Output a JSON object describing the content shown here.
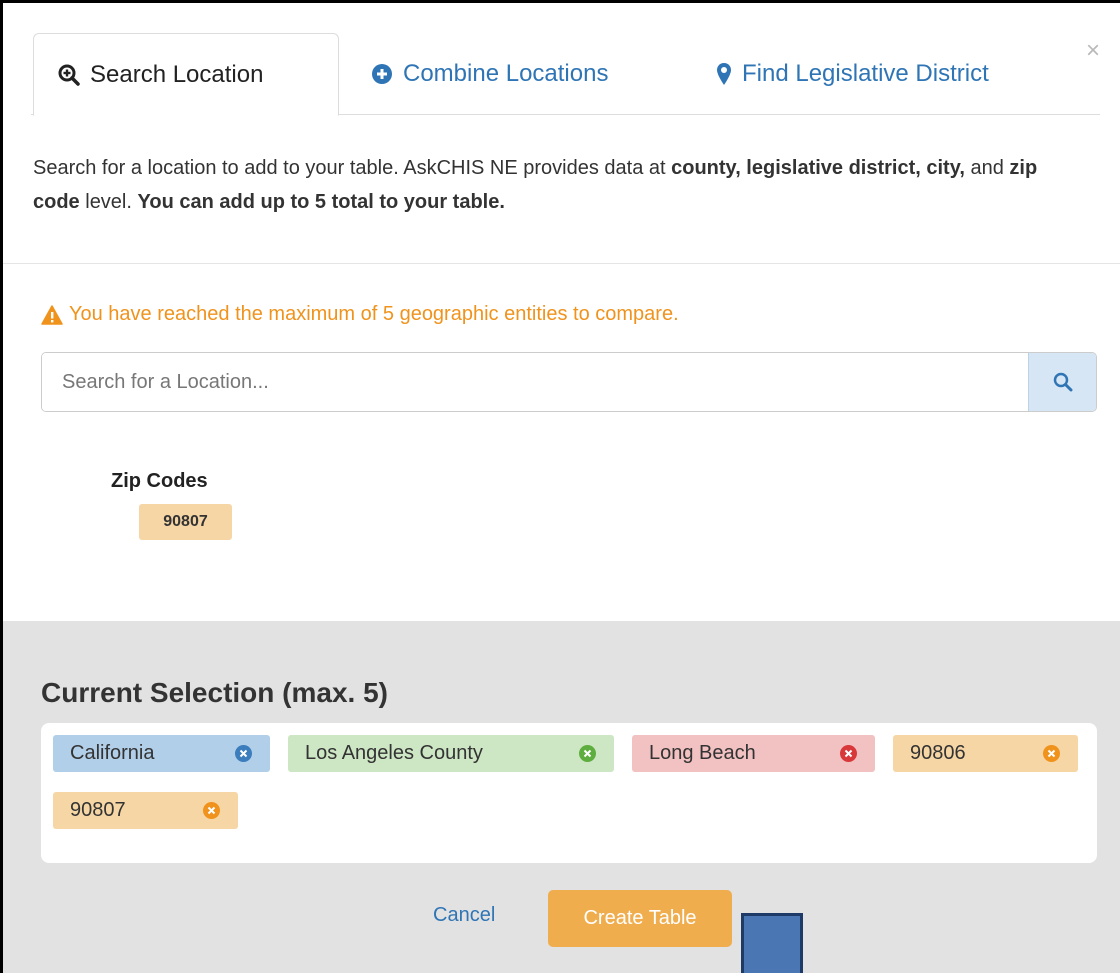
{
  "tabs": [
    {
      "label": "Search Location",
      "icon": "zoom-in-icon"
    },
    {
      "label": "Combine Locations",
      "icon": "plus-circle-icon"
    },
    {
      "label": "Find Legislative District",
      "icon": "map-marker-icon"
    }
  ],
  "close_label": "×",
  "intro": {
    "p1": "Search for a location to add to your table. AskCHIS NE provides data at ",
    "b1": "county, legislative district, city,",
    "p2": " and ",
    "b2": "zip code",
    "p3": " level. ",
    "b3": "You can add up to 5 total to your table."
  },
  "warning": "You have reached the maximum of 5 geographic entities to compare.",
  "search": {
    "placeholder": "Search for a Location...",
    "value": ""
  },
  "zip_section": {
    "heading": "Zip Codes",
    "items": [
      "90807"
    ]
  },
  "selection": {
    "title": "Current Selection (max. 5)",
    "chips": [
      {
        "label": "California",
        "color": "#b2cfe9"
      },
      {
        "label": "Los Angeles County",
        "color": "#cde6c4"
      },
      {
        "label": "Long Beach",
        "color": "#f2c2c2"
      },
      {
        "label": "90806",
        "color": "#f6d6a5"
      },
      {
        "label": "90807",
        "color": "#f6d6a5"
      }
    ]
  },
  "actions": {
    "cancel": "Cancel",
    "create": "Create Table"
  },
  "colors": {
    "link": "#2f75b5",
    "warning": "#f0931d",
    "primary_button": "#f0ad4e"
  }
}
